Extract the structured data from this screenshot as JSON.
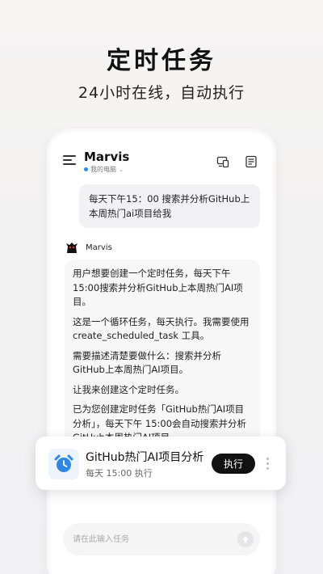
{
  "hero": {
    "title": "定时任务",
    "subtitle": "24小时在线，自动执行"
  },
  "app": {
    "title": "Marvis",
    "device_label": "我的电脑",
    "status_color": "#2d8cf0"
  },
  "chat": {
    "user_message": "每天下午15：00 搜索并分析GitHub上本周热门ai项目给我",
    "bot_name": "Marvis",
    "bot_paragraphs": [
      "用户想要创建一个定时任务，每天下午15:00搜索并分析GitHub上本周热门AI项目。",
      "这是一个循环任务，每天执行。我需要使用create_scheduled_task 工具。",
      "需要描述清楚要做什么：搜索并分析GitHub上本周热门AI项目。",
      "让我来创建这个定时任务。",
      "已为您创建定时任务「GitHub热门AI项目分析」，每天下午 15:00会自动搜索并分析GitHub本周热门AI项目。"
    ]
  },
  "input": {
    "placeholder": "请在此输入任务"
  },
  "task_card": {
    "title": "GitHub热门AI项目分析",
    "schedule": "每天 15:00 执行",
    "run_label": "执行",
    "icon": "alarm-clock-icon",
    "accent": "#2f86e6"
  }
}
